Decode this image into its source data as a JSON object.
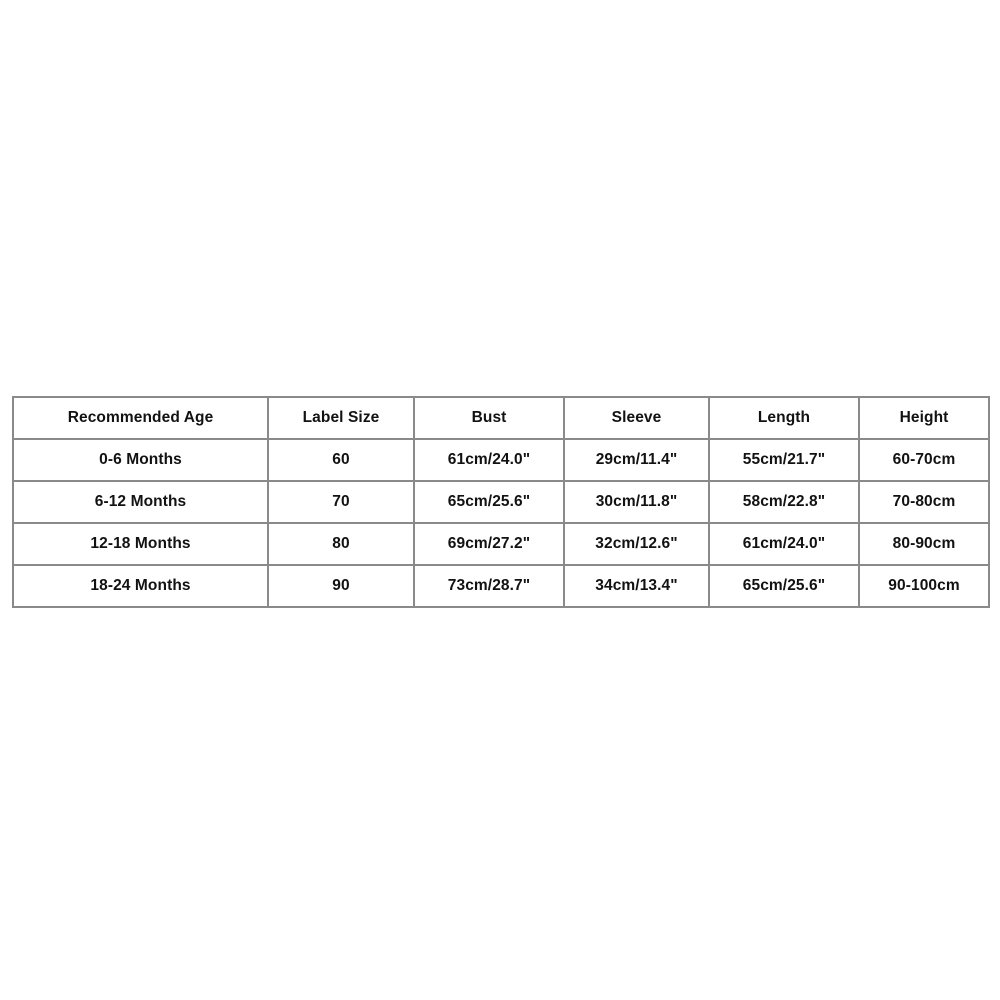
{
  "chart_data": {
    "type": "table",
    "title": "",
    "columns": [
      "Recommended Age",
      "Label Size",
      "Bust",
      "Sleeve",
      "Length",
      "Height"
    ],
    "rows": [
      {
        "recommended_age": "0-6 Months",
        "label_size": "60",
        "bust": "61cm/24.0\"",
        "sleeve": "29cm/11.4\"",
        "length": "55cm/21.7\"",
        "height": "60-70cm"
      },
      {
        "recommended_age": "6-12 Months",
        "label_size": "70",
        "bust": "65cm/25.6\"",
        "sleeve": "30cm/11.8\"",
        "length": "58cm/22.8\"",
        "height": "70-80cm"
      },
      {
        "recommended_age": "12-18 Months",
        "label_size": "80",
        "bust": "69cm/27.2\"",
        "sleeve": "32cm/12.6\"",
        "length": "61cm/24.0\"",
        "height": "80-90cm"
      },
      {
        "recommended_age": "18-24 Months",
        "label_size": "90",
        "bust": "73cm/28.7\"",
        "sleeve": "34cm/13.4\"",
        "length": "65cm/25.6\"",
        "height": "90-100cm"
      }
    ]
  },
  "style": {
    "background_color": "#ffffff",
    "border_color": "#8a8a8a",
    "text_color": "#121212"
  }
}
